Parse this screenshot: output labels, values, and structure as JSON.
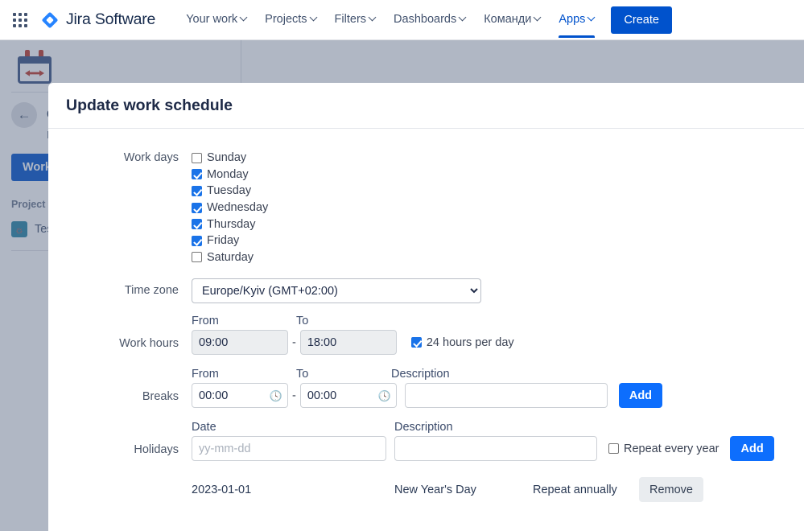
{
  "topnav": {
    "app_switcher_label": "app-switcher",
    "brand": "Jira Software",
    "items": [
      {
        "label": "Your work",
        "has_caret": true,
        "active": false
      },
      {
        "label": "Projects",
        "has_caret": true,
        "active": false
      },
      {
        "label": "Filters",
        "has_caret": true,
        "active": false
      },
      {
        "label": "Dashboards",
        "has_caret": true,
        "active": false
      },
      {
        "label": "Команди",
        "has_caret": true,
        "active": false
      },
      {
        "label": "Apps",
        "has_caret": true,
        "active": true
      }
    ],
    "create_label": "Create",
    "accent_color": "#0052cc"
  },
  "sidebar": {
    "title": "C",
    "subtitle": "N",
    "work_button": "Work s",
    "section_label": "Project",
    "project_item": "Tes"
  },
  "modal": {
    "title": "Update work schedule",
    "work_days": {
      "label": "Work days",
      "days": [
        {
          "label": "Sunday",
          "checked": false
        },
        {
          "label": "Monday",
          "checked": true
        },
        {
          "label": "Tuesday",
          "checked": true
        },
        {
          "label": "Wednesday",
          "checked": true
        },
        {
          "label": "Thursday",
          "checked": true
        },
        {
          "label": "Friday",
          "checked": true
        },
        {
          "label": "Saturday",
          "checked": false
        }
      ]
    },
    "time_zone": {
      "label": "Time zone",
      "value": "Europe/Kyiv (GMT+02:00)"
    },
    "work_hours": {
      "label": "Work hours",
      "from_label": "From",
      "to_label": "To",
      "from_value": "09:00",
      "to_value": "18:00",
      "separator": "-",
      "all_day_label": "24 hours per day",
      "all_day_checked": true
    },
    "breaks": {
      "label": "Breaks",
      "from_label": "From",
      "to_label": "To",
      "description_label": "Description",
      "from_value": "00:00",
      "to_value": "00:00",
      "description_value": "",
      "separator": "-",
      "add_label": "Add",
      "clock_icon": "clock-icon"
    },
    "holidays": {
      "label": "Holidays",
      "date_label": "Date",
      "description_label": "Description",
      "date_placeholder": "yy-mm-dd",
      "date_value": "",
      "description_value": "",
      "repeat_label": "Repeat every year",
      "repeat_checked": false,
      "add_label": "Add",
      "rows": [
        {
          "date": "2023-01-01",
          "description": "New Year's Day",
          "repeat": "Repeat annually",
          "remove_label": "Remove"
        }
      ]
    },
    "primary_color": "#0d6efd"
  }
}
